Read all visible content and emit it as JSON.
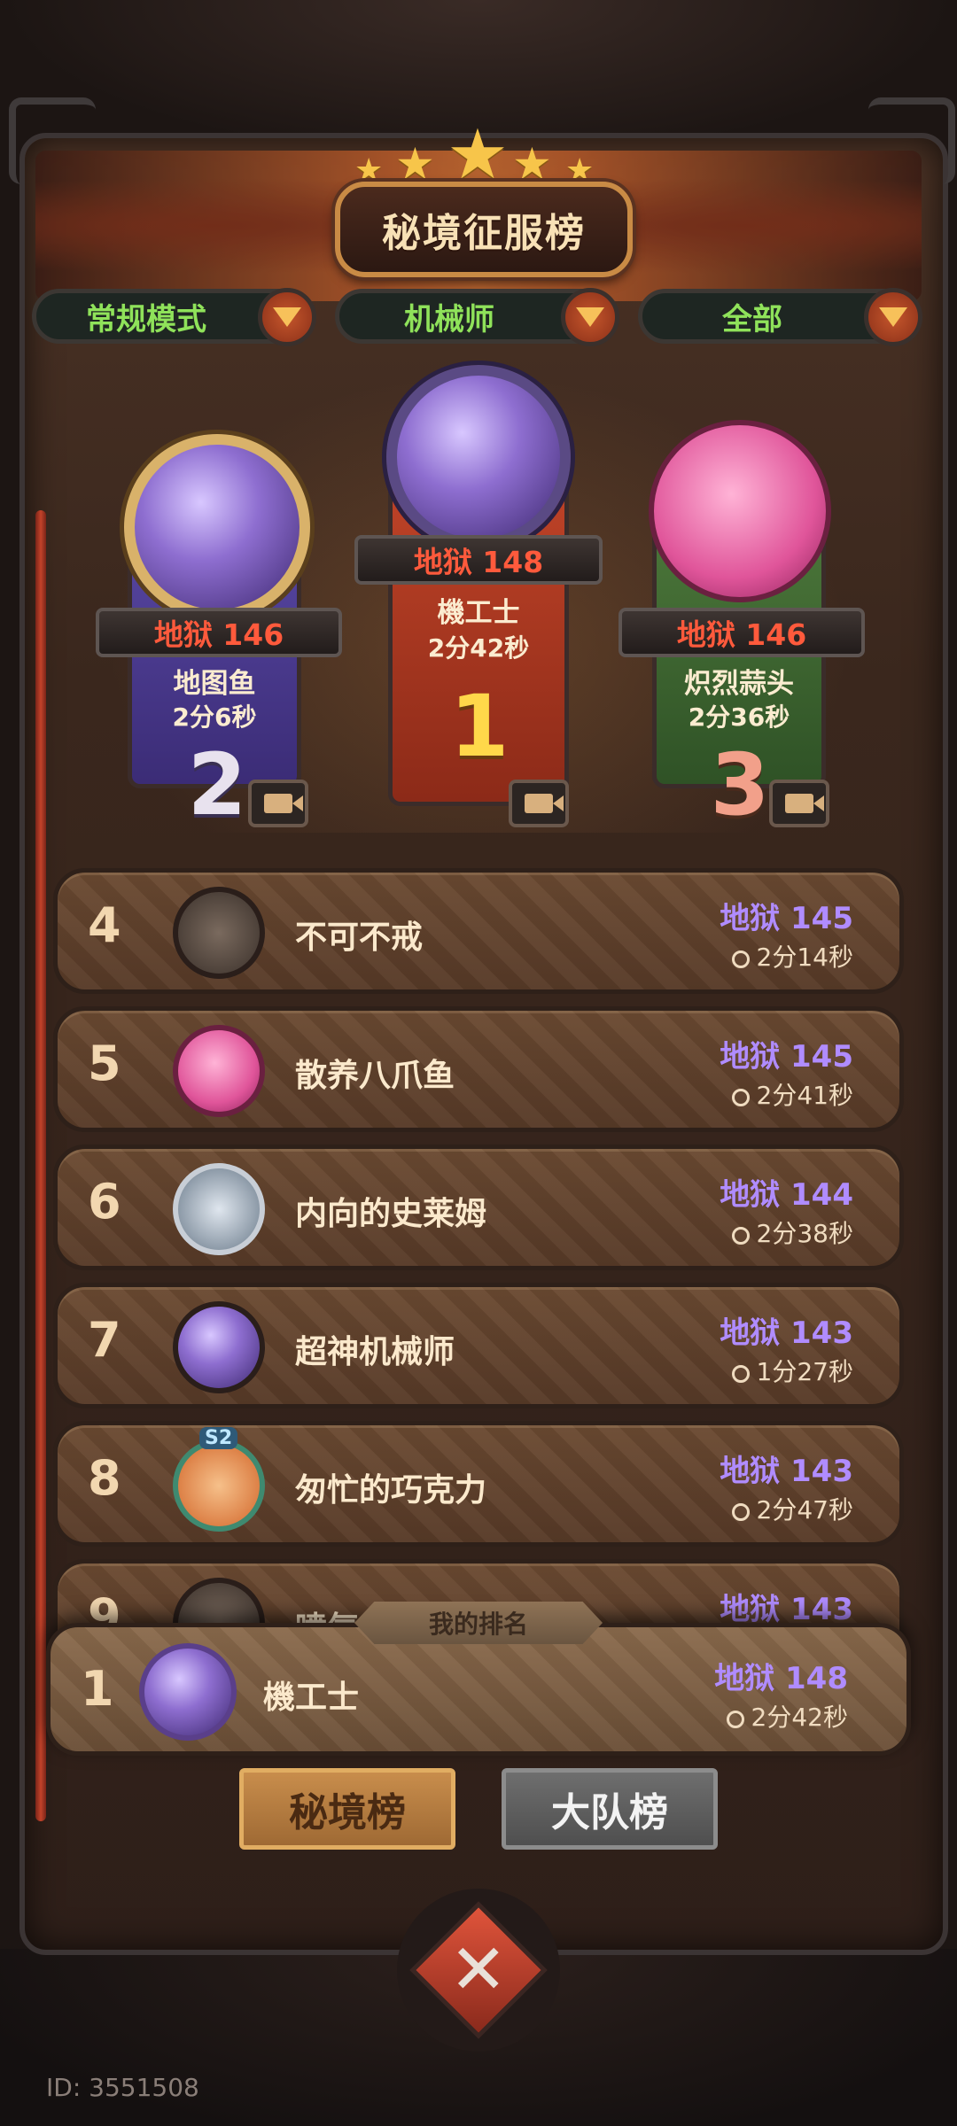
{
  "title": "秘境征服榜",
  "filters": [
    {
      "label": "常规模式"
    },
    {
      "label": "机械师"
    },
    {
      "label": "全部"
    }
  ],
  "podium": [
    {
      "rank": "2",
      "score": "地狱 146",
      "name": "地图鱼",
      "time": "2分6秒"
    },
    {
      "rank": "1",
      "score": "地狱 148",
      "name": "機工士",
      "time": "2分42秒"
    },
    {
      "rank": "3",
      "score": "地狱 146",
      "name": "炽烈蒜头",
      "time": "2分36秒"
    }
  ],
  "list": [
    {
      "rank": "4",
      "name": "不可不戒",
      "score": "地狱 145",
      "time": "2分14秒"
    },
    {
      "rank": "5",
      "name": "散养八爪鱼",
      "score": "地狱 145",
      "time": "2分41秒"
    },
    {
      "rank": "6",
      "name": "内向的史莱姆",
      "score": "地狱 144",
      "time": "2分38秒"
    },
    {
      "rank": "7",
      "name": "超神机械师",
      "score": "地狱 143",
      "time": "1分27秒"
    },
    {
      "rank": "8",
      "name": "匆忙的巧克力",
      "score": "地狱 143",
      "time": "2分47秒"
    },
    {
      "rank": "9",
      "name": "喷气",
      "score": "地狱 143",
      "time": ""
    }
  ],
  "badge_s2": "S2",
  "my_rank": {
    "tag": "我的排名",
    "rank": "1",
    "name": "機工士",
    "score": "地狱 148",
    "time": "2分42秒"
  },
  "tabs": {
    "active": "秘境榜",
    "inactive": "大队榜"
  },
  "close_symbol": "✕",
  "user_id": "ID: 3551508",
  "colors": {
    "score_red": "#ff5a3c",
    "score_purple": "#b08cff",
    "filter_green": "#8fe25a"
  }
}
